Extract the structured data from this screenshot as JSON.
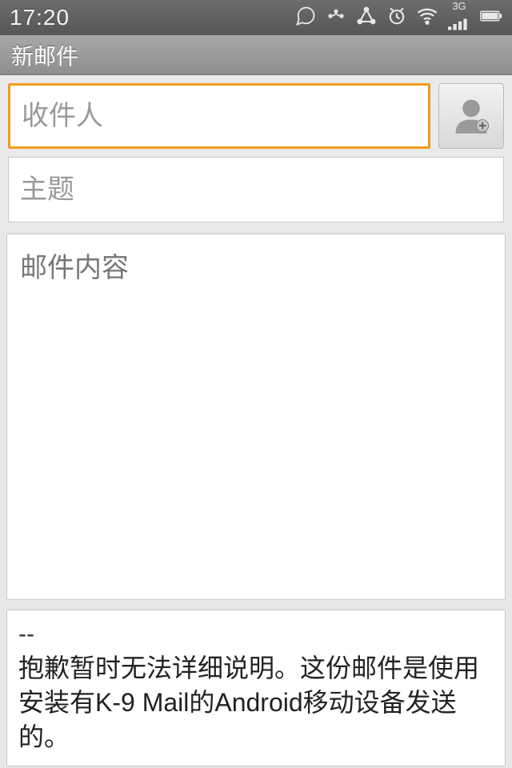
{
  "status": {
    "time": "17:20",
    "network_label": "3G"
  },
  "title": "新邮件",
  "compose": {
    "recipient_placeholder": "收件人",
    "subject_placeholder": "主题",
    "body_placeholder": "邮件内容"
  },
  "signature": {
    "separator": "--",
    "text": "抱歉暂时无法详细说明。这份邮件是使用安装有K-9 Mail的Android移动设备发送的。"
  }
}
